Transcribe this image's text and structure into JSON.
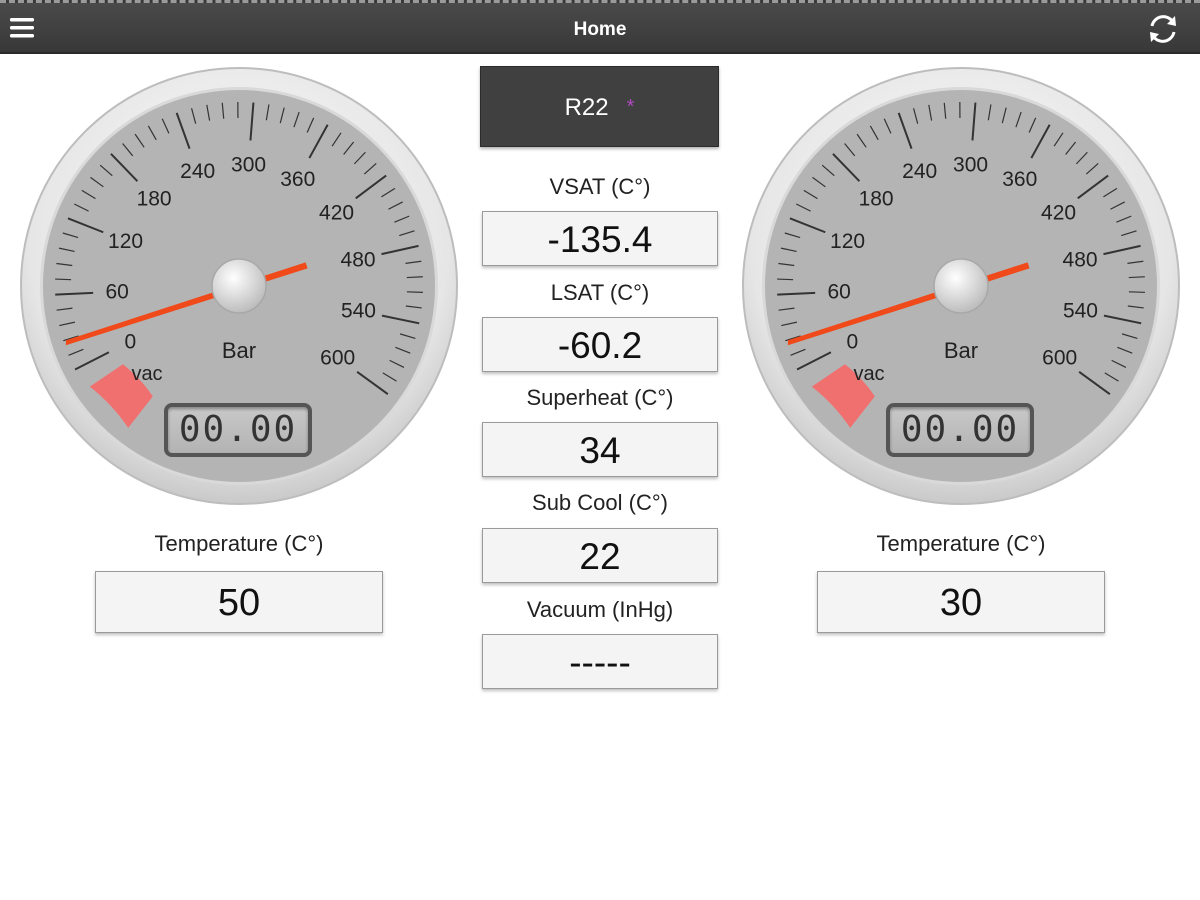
{
  "header": {
    "title": "Home",
    "menu_icon": "hamburger-icon",
    "refresh_icon": "refresh-icon"
  },
  "gauges": {
    "scale_labels": [
      "0",
      "60",
      "120",
      "180",
      "240",
      "300",
      "360",
      "420",
      "480",
      "540",
      "600"
    ],
    "unit": "Bar",
    "vac_label": "vac",
    "left": {
      "lcd_value": "00.00",
      "temperature_label": "Temperature (C°)",
      "temperature_value": "50"
    },
    "right": {
      "lcd_value": "00.00",
      "temperature_label": "Temperature (C°)",
      "temperature_value": "30"
    }
  },
  "refrigerant": {
    "name": "R22",
    "marker": "*"
  },
  "fields": [
    {
      "label": "VSAT (C°)",
      "value": "-135.4"
    },
    {
      "label": "LSAT (C°)",
      "value": "-60.2"
    },
    {
      "label": "Superheat (C°)",
      "value": "34"
    },
    {
      "label": "Sub Cool (C°)",
      "value": "22"
    },
    {
      "label": "Vacuum (InHg)",
      "value": "-----"
    }
  ],
  "colors": {
    "header": "#3f3f3f",
    "needle": "#f04a1a",
    "vac_zone": "#f07070",
    "dial": "#b4b4b4"
  }
}
